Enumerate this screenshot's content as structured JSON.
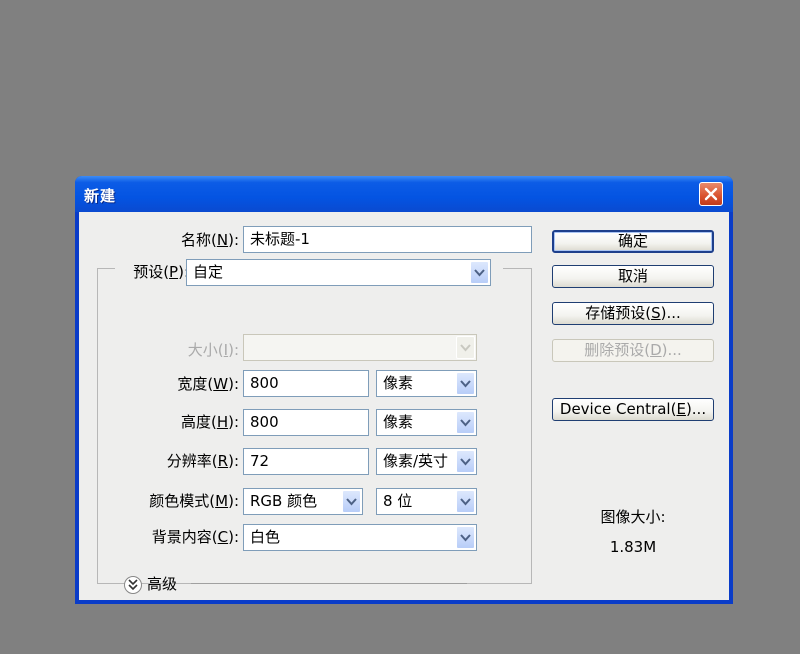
{
  "dialog": {
    "title": "新建",
    "close_icon": "close-icon"
  },
  "form": {
    "name": {
      "label_pre": "名称(",
      "label_key": "N",
      "label_post": "):",
      "value": "未标题-1"
    },
    "preset": {
      "label_pre": "预设(",
      "label_key": "P",
      "label_post": "):",
      "value": "自定"
    },
    "size": {
      "label_pre": "大小(",
      "label_key": "I",
      "label_post": "):",
      "value": ""
    },
    "width": {
      "label_pre": "宽度(",
      "label_key": "W",
      "label_post": "):",
      "value": "800",
      "unit": "像素"
    },
    "height": {
      "label_pre": "高度(",
      "label_key": "H",
      "label_post": "):",
      "value": "800",
      "unit": "像素"
    },
    "resolution": {
      "label_pre": "分辨率(",
      "label_key": "R",
      "label_post": "):",
      "value": "72",
      "unit": "像素/英寸"
    },
    "color_mode": {
      "label_pre": "颜色模式(",
      "label_key": "M",
      "label_post": "):",
      "value": "RGB 颜色",
      "depth": "8 位"
    },
    "background": {
      "label_pre": "背景内容(",
      "label_key": "C",
      "label_post": "):",
      "value": "白色"
    },
    "advanced": {
      "label": "高级",
      "icon": "chevron-double-down-icon"
    }
  },
  "buttons": {
    "ok": "确定",
    "cancel": "取消",
    "save_preset": {
      "pre": "存储预设(",
      "key": "S",
      "post": ")..."
    },
    "delete_preset": {
      "pre": "删除预设(",
      "key": "D",
      "post": ")..."
    },
    "device_central": {
      "pre": "Device Central(",
      "key": "E",
      "post": ")..."
    }
  },
  "image_size": {
    "label": "图像大小:",
    "value": "1.83M"
  },
  "colors": {
    "titlebar": "#0454e2",
    "client": "#eeeeed",
    "desktop": "#808080",
    "close": "#d9522f"
  }
}
